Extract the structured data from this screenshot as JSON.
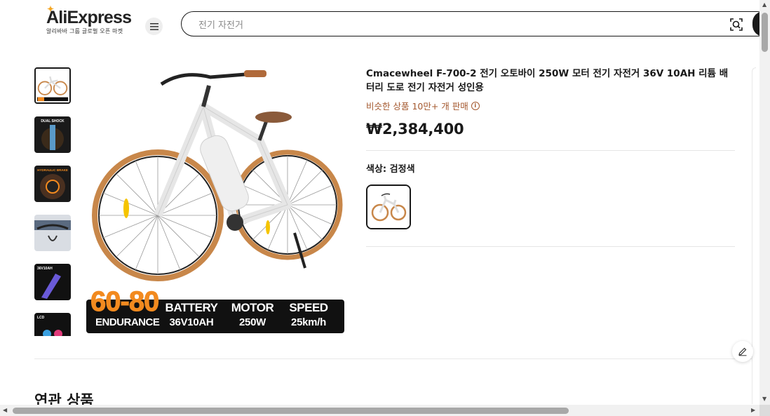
{
  "header": {
    "logo_text": "AliExpress",
    "logo_subtitle": "알리바바 그룹 글로벌 오픈 마켓",
    "search_placeholder": "전기 자전거"
  },
  "icons": {
    "menu": "menu-icon",
    "image_search": "camera-search-icon",
    "edit": "pencil-icon",
    "info": "info-icon"
  },
  "gallery": {
    "thumbnails": [
      {
        "label": "",
        "selected": true
      },
      {
        "label": "DUAL SHOCK"
      },
      {
        "label": "HYDRAULIC BRAKE"
      },
      {
        "label": ""
      },
      {
        "label": "36V10AH"
      },
      {
        "label": "LCD"
      }
    ],
    "specs_banner": {
      "endurance_value": "60-80",
      "endurance_label": "ENDURANCE",
      "battery_label": "BATTERY",
      "battery_value": "36V10AH",
      "motor_label": "MOTOR",
      "motor_value": "250W",
      "speed_label": "SPEED",
      "speed_value": "25km/h"
    }
  },
  "product": {
    "title": "Cmacewheel F-700-2 전기 오토바이 250W 모터 전기 자전거 36V 10AH 리튬 배터리 도로 전기 자전거 성인용",
    "sold_text": "비슷한 상품 10만+ 개 판매",
    "price": "₩2,384,400",
    "color_label": "색상: 검정색",
    "accent_color": "#a4582e"
  },
  "related": {
    "heading": "연관 상품"
  }
}
